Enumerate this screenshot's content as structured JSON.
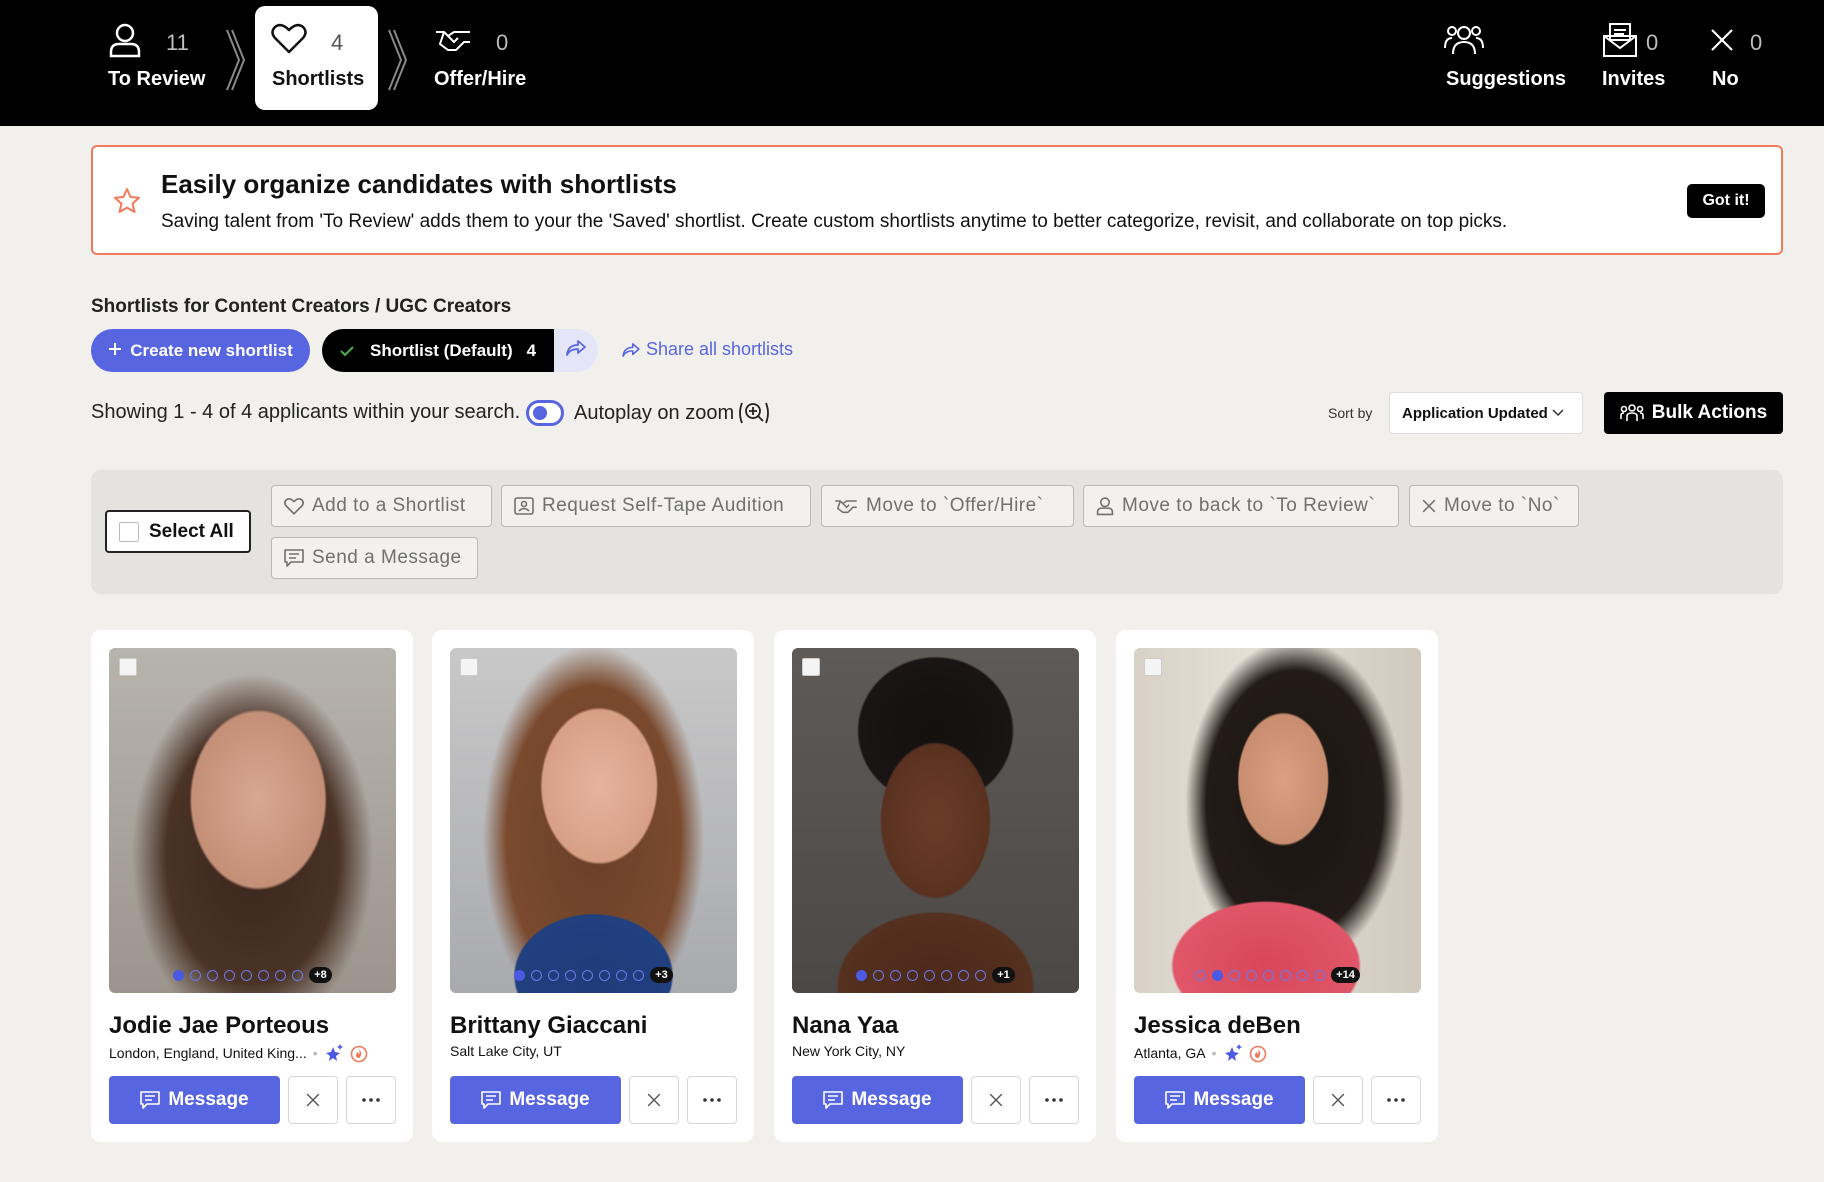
{
  "stages": {
    "to_review": {
      "count": "11",
      "label": "To Review"
    },
    "shortlists": {
      "count": "4",
      "label": "Shortlists"
    },
    "offer_hire": {
      "count": "0",
      "label": "Offer/Hire"
    },
    "suggestions": {
      "label": "Suggestions"
    },
    "invites": {
      "count": "0",
      "label": "Invites"
    },
    "no": {
      "count": "0",
      "label": "No"
    }
  },
  "banner": {
    "title": "Easily organize candidates with shortlists",
    "text": "Saving talent from 'To Review' adds them to your the 'Saved' shortlist. Create custom shortlists anytime to better categorize, revisit, and collaborate on top picks.",
    "button": "Got it!"
  },
  "shortlists": {
    "title": "Shortlists for Content Creators / UGC Creators",
    "create_label": "Create new shortlist",
    "default_label": "Shortlist (Default)",
    "default_count": "4",
    "share_all_label": "Share all shortlists"
  },
  "results": {
    "showing": "Showing 1 - 4 of 4 applicants within your search.",
    "autoplay_label": "Autoplay on zoom"
  },
  "sort": {
    "label": "Sort by",
    "value": "Application Updated"
  },
  "bulk_label": "Bulk Actions",
  "actions": {
    "select_all": "Select All",
    "add_shortlist": "Add to a Shortlist",
    "self_tape": "Request Self-Tape Audition",
    "move_offer": "Move to `Offer/Hire`",
    "move_review": "Move to back to `To Review`",
    "move_no": "Move to `No`",
    "send_message": "Send a Message"
  },
  "message_label": "Message",
  "cards": [
    {
      "name": "Jodie Jae Porteous",
      "location": "London, England, United King...",
      "more": "+8",
      "active_dot": 0
    },
    {
      "name": "Brittany Giaccani",
      "location": "Salt Lake City, UT",
      "more": "+3",
      "active_dot": 0
    },
    {
      "name": "Nana Yaa",
      "location": "New York City, NY",
      "more": "+1",
      "active_dot": 0
    },
    {
      "name": "Jessica deBen",
      "location": "Atlanta, GA",
      "more": "+14",
      "active_dot": 1
    }
  ],
  "colors": {
    "accent": "#5865e0",
    "banner_border": "#f07a5a",
    "topbar": "#000000",
    "page_bg": "#f2f0ec"
  }
}
